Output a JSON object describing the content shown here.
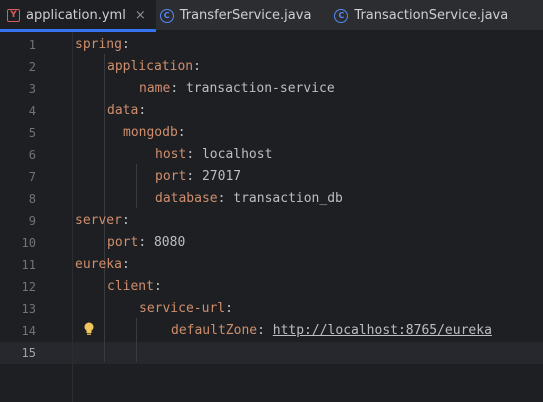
{
  "tabs": [
    {
      "label": "application.yml",
      "icon": "yaml-file-icon",
      "active": true,
      "close": "×"
    },
    {
      "label": "TransferService.java",
      "icon": "java-class-icon",
      "active": false
    },
    {
      "label": "TransactionService.java",
      "icon": "java-class-icon",
      "active": false
    }
  ],
  "icons": {
    "yml": "Y",
    "class": "C"
  },
  "lines": [
    {
      "n": "1",
      "indent": 0,
      "key": "spring",
      "sep": ":",
      "val": ""
    },
    {
      "n": "2",
      "indent": 1,
      "key": "application",
      "sep": ":",
      "val": ""
    },
    {
      "n": "3",
      "indent": 2,
      "key": "name",
      "sep": ": ",
      "val": "transaction-service"
    },
    {
      "n": "4",
      "indent": 1,
      "key": "data",
      "sep": ":",
      "val": ""
    },
    {
      "n": "5",
      "indent": 1.5,
      "key": "mongodb",
      "sep": ":",
      "val": ""
    },
    {
      "n": "6",
      "indent": 2.5,
      "key": "host",
      "sep": ": ",
      "val": "localhost"
    },
    {
      "n": "7",
      "indent": 2.5,
      "key": "port",
      "sep": ": ",
      "val": "27017"
    },
    {
      "n": "8",
      "indent": 2.5,
      "key": "database",
      "sep": ": ",
      "val": "transaction_db"
    },
    {
      "n": "9",
      "indent": 0,
      "key": "server",
      "sep": ":",
      "val": ""
    },
    {
      "n": "10",
      "indent": 1,
      "key": "port",
      "sep": ": ",
      "val": "8080"
    },
    {
      "n": "11",
      "indent": 0,
      "key": "eureka",
      "sep": ":",
      "val": ""
    },
    {
      "n": "12",
      "indent": 1,
      "key": "client",
      "sep": ":",
      "val": ""
    },
    {
      "n": "13",
      "indent": 2,
      "key": "service-url",
      "sep": ":",
      "val": ""
    },
    {
      "n": "14",
      "indent": 3,
      "key": "defaultZone",
      "sep": ": ",
      "val": "http://localhost:8765/eureka",
      "link": true
    },
    {
      "n": "15",
      "indent": 0,
      "key": "",
      "sep": "",
      "val": ""
    }
  ],
  "current_line": "15",
  "colors": {
    "key": "#cf8e6d",
    "text": "#bcbec4",
    "accent": "#3574f0",
    "bulb": "#f2c55c"
  }
}
